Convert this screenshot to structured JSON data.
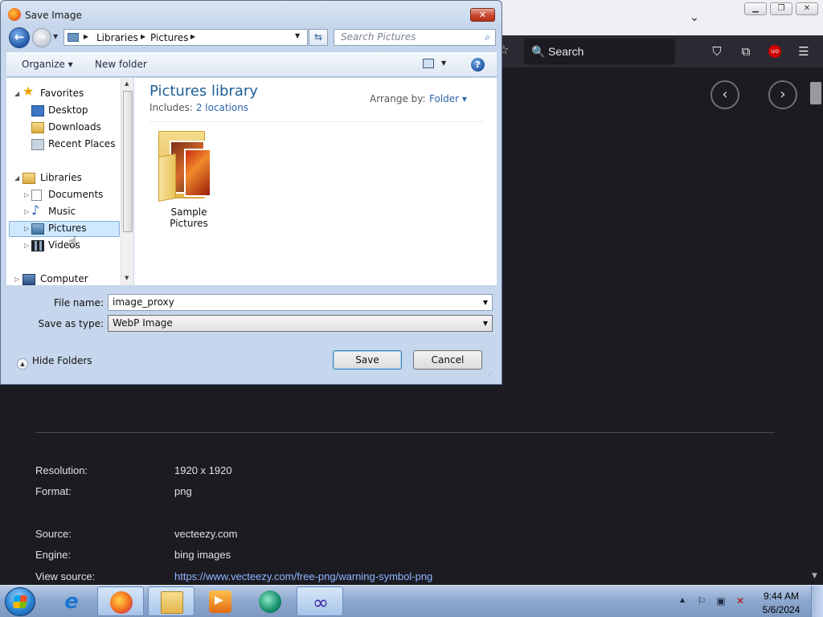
{
  "browser": {
    "tab_list_glyph": "⌄",
    "search_placeholder": "Search",
    "nav_prev_glyph": "‹",
    "nav_next_glyph": "›",
    "ublock_label": "uo",
    "image_info": [
      {
        "label": "Resolution:",
        "value": "1920 x 1920"
      },
      {
        "label": "Format:",
        "value": "png"
      },
      {
        "label": "Source:",
        "value": "vecteezy.com"
      },
      {
        "label": "Engine:",
        "value": "bing images"
      },
      {
        "label": "View source:",
        "value": "https://www.vecteezy.com/free-png/warning-symbol-png"
      }
    ]
  },
  "dialog": {
    "title": "Save Image",
    "breadcrumb": [
      "Libraries",
      "Pictures"
    ],
    "search_placeholder": "Search Pictures",
    "commands": {
      "organize": "Organize ▾",
      "new_folder": "New folder"
    },
    "nav_tree": {
      "favorites": "Favorites",
      "desktop": "Desktop",
      "downloads": "Downloads",
      "recent_places": "Recent Places",
      "libraries": "Libraries",
      "documents": "Documents",
      "music": "Music",
      "pictures": "Pictures",
      "videos": "Videos",
      "computer": "Computer"
    },
    "library": {
      "title": "Pictures library",
      "includes_label": "Includes:",
      "includes_value": "2 locations",
      "arrange_label": "Arrange by:",
      "arrange_value": "Folder ▾"
    },
    "items": [
      {
        "name": "Sample Pictures"
      }
    ],
    "file_name_label": "File name:",
    "file_name_value": "image_proxy",
    "save_type_label": "Save as type:",
    "save_type_value": "WebP Image",
    "hide_folders": "Hide Folders",
    "save_button": "Save",
    "cancel_button": "Cancel"
  },
  "taskbar": {
    "apps": [
      "internet-explorer",
      "firefox",
      "windows-explorer",
      "media-player",
      "teal-app",
      "infinity-app"
    ],
    "clock_time": "9:44 AM",
    "clock_date": "5/6/2024"
  },
  "colors": {
    "browser_bg": "#1c1b22",
    "link": "#8eb5ff",
    "library_title": "#1e5f96",
    "selection": "#cde8ff"
  }
}
